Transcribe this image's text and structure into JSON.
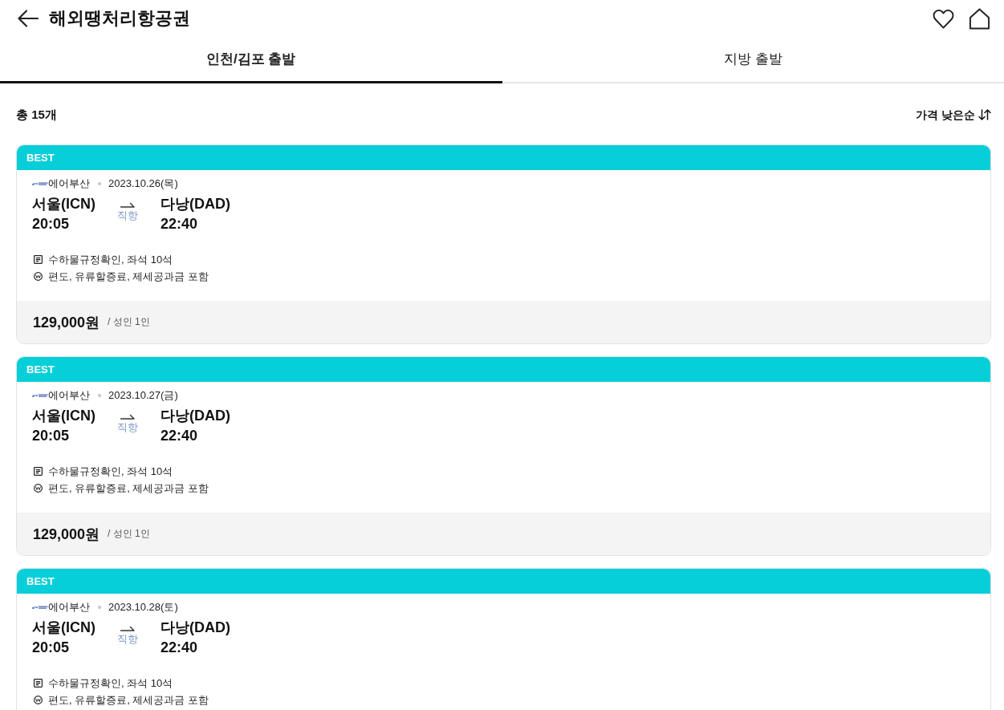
{
  "header": {
    "title": "해외땡처리항공권"
  },
  "tabs": [
    {
      "label": "인천/김포 출발",
      "selected": true
    },
    {
      "label": "지방 출발",
      "selected": false
    }
  ],
  "summary": {
    "count": "총 15개",
    "sort": "가격 낮은순"
  },
  "cards": [
    {
      "badge": "BEST",
      "airline": "에어부산",
      "date": "2023.10.26(목)",
      "from": {
        "city": "서울(ICN)",
        "time": "20:05"
      },
      "stop": "직항",
      "to": {
        "city": "다낭(DAD)",
        "time": "22:40"
      },
      "info": [
        {
          "kind": "baggage",
          "text": "수하물규정확인, 좌석 10석"
        },
        {
          "kind": "fare",
          "text": "편도, 유류할증료, 제세공과금 포함"
        }
      ],
      "price": "129,000원",
      "price_note": "/ 성인 1인"
    },
    {
      "badge": "BEST",
      "airline": "에어부산",
      "date": "2023.10.27(금)",
      "from": {
        "city": "서울(ICN)",
        "time": "20:05"
      },
      "stop": "직항",
      "to": {
        "city": "다낭(DAD)",
        "time": "22:40"
      },
      "info": [
        {
          "kind": "baggage",
          "text": "수하물규정확인, 좌석 10석"
        },
        {
          "kind": "fare",
          "text": "편도, 유류할증료, 제세공과금 포함"
        }
      ],
      "price": "129,000원",
      "price_note": "/ 성인 1인"
    },
    {
      "badge": "BEST",
      "airline": "에어부산",
      "date": "2023.10.28(토)",
      "from": {
        "city": "서울(ICN)",
        "time": "20:05"
      },
      "stop": "직항",
      "to": {
        "city": "다낭(DAD)",
        "time": "22:40"
      },
      "info": [
        {
          "kind": "baggage",
          "text": "수하물규정확인, 좌석 10석"
        },
        {
          "kind": "fare",
          "text": "편도, 유류할증료, 제세공과금 포함"
        }
      ]
    }
  ]
}
